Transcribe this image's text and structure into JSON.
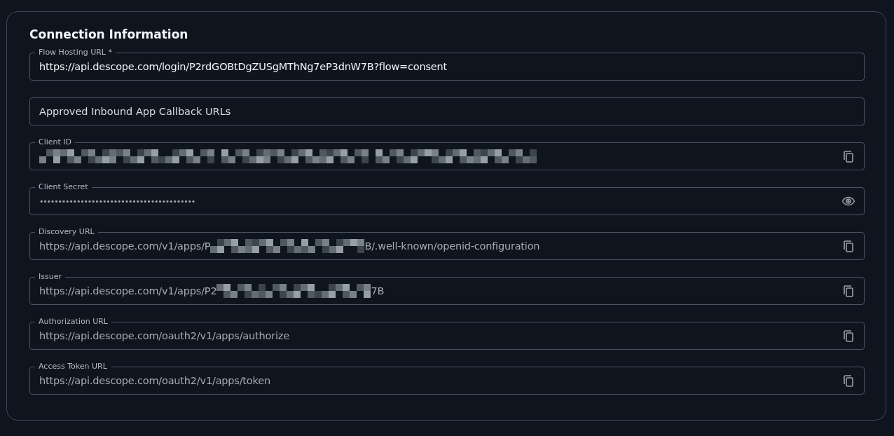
{
  "section": {
    "title": "Connection Information"
  },
  "fields": [
    {
      "kind": "editable",
      "label": "Flow Hosting URL *",
      "parts": [
        {
          "kind": "text",
          "text": "https://api.descope.com/login/P2rdGOBtDgZUSgMThNg7eP3dnW7B?flow=consent",
          "disabled": false
        }
      ]
    },
    {
      "kind": "editable",
      "placeholder": "Approved Inbound App Callback URLs"
    },
    {
      "kind": "copyable",
      "label": "Client ID",
      "parts": [
        {
          "kind": "redacted"
        }
      ]
    },
    {
      "kind": "secret",
      "label": "Client Secret",
      "parts": [
        {
          "kind": "text",
          "text": "••••••••••••••••••••••••••••••••••••••••••",
          "disabled": true
        }
      ]
    },
    {
      "kind": "copyable",
      "label": "Discovery URL",
      "parts": [
        {
          "kind": "text",
          "text": "https://api.descope.com/v1/apps/P",
          "disabled": true
        },
        {
          "kind": "redacted"
        },
        {
          "kind": "text",
          "text": "B/.well-known/openid-configuration",
          "disabled": true
        }
      ]
    },
    {
      "kind": "copyable",
      "label": "Issuer",
      "parts": [
        {
          "kind": "text",
          "text": "https://api.descope.com/v1/apps/P2",
          "disabled": true
        },
        {
          "kind": "redacted"
        },
        {
          "kind": "text",
          "text": "7B",
          "disabled": true
        }
      ]
    },
    {
      "kind": "copyable",
      "label": "Authorization URL",
      "parts": [
        {
          "kind": "text",
          "text": "https://api.descope.com/oauth2/v1/apps/authorize",
          "disabled": true
        }
      ]
    },
    {
      "kind": "copyable",
      "label": "Access Token URL",
      "parts": [
        {
          "kind": "text",
          "text": "https://api.descope.com/oauth2/v1/apps/token",
          "disabled": true
        }
      ]
    }
  ]
}
